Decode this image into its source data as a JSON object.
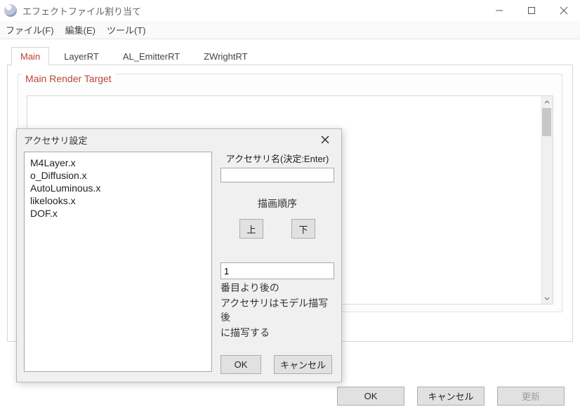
{
  "window": {
    "title": "エフェクトファイル割り当て"
  },
  "menu": {
    "file": "ファイル(F)",
    "edit": "編集(E)",
    "tool": "ツール(T)"
  },
  "tabs": [
    "Main",
    "LayerRT",
    "AL_EmitterRT",
    "ZWrightRT"
  ],
  "active_tab": 0,
  "group": {
    "label": "Main Render Target"
  },
  "footer": {
    "ok": "OK",
    "cancel": "キャンセル",
    "update": "更新"
  },
  "dialog": {
    "title": "アクセサリ設定",
    "list": [
      "M4Layer.x",
      "o_Diffusion.x",
      "AutoLuminous.x",
      "likelooks.x",
      "DOF.x"
    ],
    "name_label": "アクセサリ名(決定:Enter)",
    "name_value": "",
    "order_label": "描画順序",
    "up": "上",
    "down": "下",
    "order_value": "1",
    "order_suffix1": "番目より後の",
    "order_line2": "アクセサリはモデル描写後",
    "order_line3": "に描写する",
    "ok": "OK",
    "cancel": "キャンセル"
  }
}
